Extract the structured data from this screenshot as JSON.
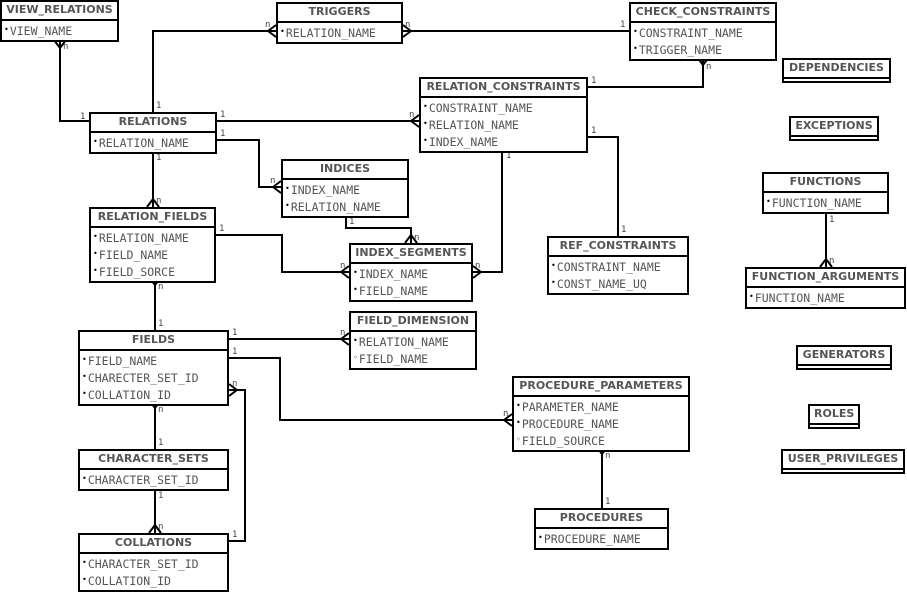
{
  "entities": {
    "view_relations": {
      "title": "VIEW_RELATIONS",
      "fields": [
        {
          "name": "VIEW_NAME",
          "bullet": "•"
        }
      ]
    },
    "triggers": {
      "title": "TRIGGERS",
      "fields": [
        {
          "name": "RELATION_NAME",
          "bullet": "•"
        }
      ]
    },
    "check_constraints": {
      "title": "CHECK_CONSTRAINTS",
      "fields": [
        {
          "name": "CONSTRAINT_NAME",
          "bullet": "•"
        },
        {
          "name": "TRIGGER_NAME",
          "bullet": "•"
        }
      ]
    },
    "dependencies": {
      "title": "DEPENDENCIES",
      "fields": []
    },
    "relation_constraints": {
      "title": "RELATION_CONSTRAINTS",
      "fields": [
        {
          "name": "CONSTRAINT_NAME",
          "bullet": "•"
        },
        {
          "name": "RELATION_NAME",
          "bullet": "•"
        },
        {
          "name": "INDEX_NAME",
          "bullet": "•"
        }
      ]
    },
    "relations": {
      "title": "RELATIONS",
      "fields": [
        {
          "name": "RELATION_NAME",
          "bullet": "•"
        }
      ]
    },
    "exceptions": {
      "title": "EXCEPTIONS",
      "fields": []
    },
    "indices": {
      "title": "INDICES",
      "fields": [
        {
          "name": "INDEX_NAME",
          "bullet": "•"
        },
        {
          "name": "RELATION_NAME",
          "bullet": "•"
        }
      ]
    },
    "functions": {
      "title": "FUNCTIONS",
      "fields": [
        {
          "name": "FUNCTION_NAME",
          "bullet": "•"
        }
      ]
    },
    "relation_fields": {
      "title": "RELATION_FIELDS",
      "fields": [
        {
          "name": "RELATION_NAME",
          "bullet": "•"
        },
        {
          "name": "FIELD_NAME",
          "bullet": "•"
        },
        {
          "name": "FIELD_SORCE",
          "bullet": "•"
        }
      ]
    },
    "index_segments": {
      "title": "INDEX_SEGMENTS",
      "fields": [
        {
          "name": "INDEX_NAME",
          "bullet": "•"
        },
        {
          "name": "FIELD_NAME",
          "bullet": "•"
        }
      ]
    },
    "ref_constraints": {
      "title": "REF_CONSTRAINTS",
      "fields": [
        {
          "name": "CONSTRAINT_NAME",
          "bullet": "•"
        },
        {
          "name": "CONST_NAME_UQ",
          "bullet": "•"
        }
      ]
    },
    "function_arguments": {
      "title": "FUNCTION_ARGUMENTS",
      "fields": [
        {
          "name": "FUNCTION_NAME",
          "bullet": "•"
        }
      ]
    },
    "fields": {
      "title": "FIELDS",
      "fields": [
        {
          "name": "FIELD_NAME",
          "bullet": "•"
        },
        {
          "name": "CHARECTER_SET_ID",
          "bullet": "•"
        },
        {
          "name": "COLLATION_ID",
          "bullet": "•"
        }
      ]
    },
    "field_dimension": {
      "title": "FIELD_DIMENSION",
      "fields": [
        {
          "name": "RELATION_NAME",
          "bullet": "•"
        },
        {
          "name": "FIELD_NAME",
          "bullet": "◦"
        }
      ]
    },
    "generators": {
      "title": "GENERATORS",
      "fields": []
    },
    "procedure_parameters": {
      "title": "PROCEDURE_PARAMETERS",
      "fields": [
        {
          "name": "PARAMETER_NAME",
          "bullet": "•"
        },
        {
          "name": "PROCEDURE_NAME",
          "bullet": "•"
        },
        {
          "name": "FIELD_SOURCE",
          "bullet": "◦"
        }
      ]
    },
    "roles": {
      "title": "ROLES",
      "fields": []
    },
    "character_sets": {
      "title": "CHARACTER_SETS",
      "fields": [
        {
          "name": "CHARACTER_SET_ID",
          "bullet": "•"
        }
      ]
    },
    "user_privileges": {
      "title": "USER_PRIVILEGES",
      "fields": []
    },
    "procedures": {
      "title": "PROCEDURES",
      "fields": [
        {
          "name": "PROCEDURE_NAME",
          "bullet": "•"
        }
      ]
    },
    "collations": {
      "title": "COLLATIONS",
      "fields": [
        {
          "name": "CHARACTER_SET_ID",
          "bullet": "•"
        },
        {
          "name": "COLLATION_ID",
          "bullet": "•"
        }
      ]
    }
  },
  "relationships": [
    {
      "from": "relations",
      "to": "view_relations",
      "from_card": "1",
      "to_card": "n"
    },
    {
      "from": "relations",
      "to": "triggers",
      "from_card": "1",
      "to_card": "n"
    },
    {
      "from": "check_constraints",
      "to": "triggers",
      "from_card": "1",
      "to_card": "n"
    },
    {
      "from": "relation_constraints",
      "to": "check_constraints",
      "from_card": "1",
      "to_card": "n"
    },
    {
      "from": "relations",
      "to": "relation_constraints",
      "from_card": "1",
      "to_card": "n"
    },
    {
      "from": "relations",
      "to": "indices",
      "from_card": "1",
      "to_card": "n"
    },
    {
      "from": "relations",
      "to": "relation_fields",
      "from_card": "1",
      "to_card": "n"
    },
    {
      "from": "indices",
      "to": "index_segments",
      "from_card": "1",
      "to_card": "n"
    },
    {
      "from": "relation_fields",
      "to": "index_segments",
      "from_card": "1",
      "to_card": "n"
    },
    {
      "from": "relation_constraints",
      "to": "index_segments",
      "from_card": "1",
      "to_card": "n"
    },
    {
      "from": "relation_constraints",
      "to": "ref_constraints",
      "from_card": "1",
      "to_card": "1"
    },
    {
      "from": "functions",
      "to": "function_arguments",
      "from_card": "1",
      "to_card": "n"
    },
    {
      "from": "fields",
      "to": "relation_fields",
      "from_card": "1",
      "to_card": "n"
    },
    {
      "from": "fields",
      "to": "field_dimension",
      "from_card": "1",
      "to_card": "n"
    },
    {
      "from": "fields",
      "to": "procedure_parameters",
      "from_card": "1",
      "to_card": "n"
    },
    {
      "from": "character_sets",
      "to": "fields",
      "from_card": "1",
      "to_card": "n"
    },
    {
      "from": "collations",
      "to": "fields",
      "from_card": "1",
      "to_card": "n"
    },
    {
      "from": "character_sets",
      "to": "collations",
      "from_card": "1",
      "to_card": "n"
    },
    {
      "from": "procedures",
      "to": "procedure_parameters",
      "from_card": "1",
      "to_card": "n"
    }
  ]
}
